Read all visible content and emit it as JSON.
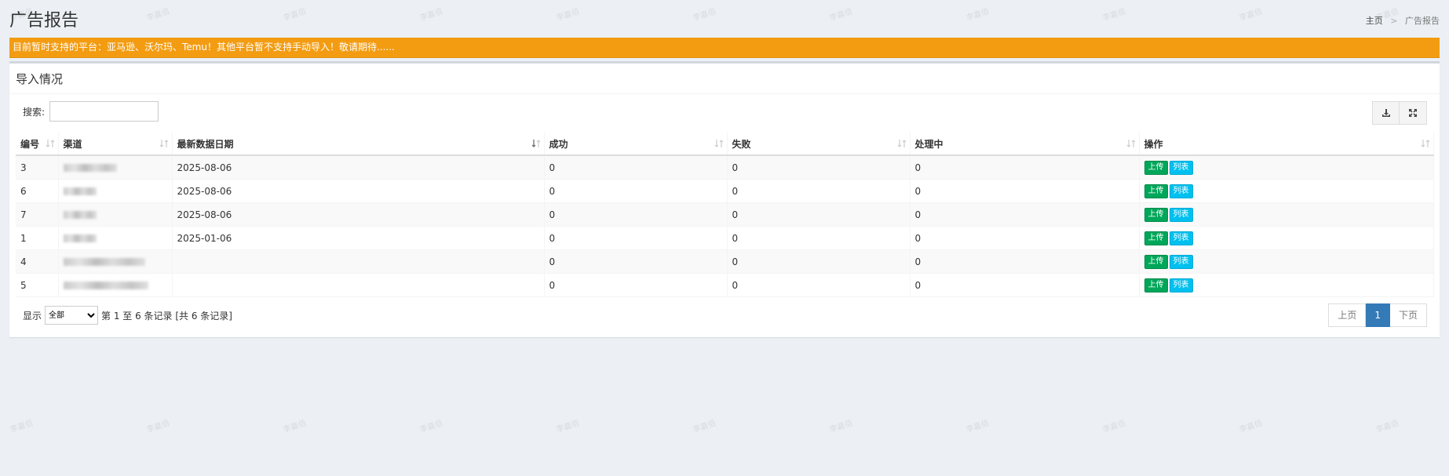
{
  "header": {
    "title": "广告报告",
    "breadcrumb": {
      "home": "主页",
      "separator": ">",
      "current": "广告报告"
    }
  },
  "notice": {
    "text": "目前暂时支持的平台：亚马逊、沃尔玛、Temu！其他平台暂不支持手动导入！敬请期待......"
  },
  "box": {
    "title": "导入情况",
    "search_label": "搜索:",
    "search_value": ""
  },
  "table": {
    "columns": [
      "编号",
      "渠道",
      "最新数据日期",
      "成功",
      "失败",
      "处理中",
      "操作"
    ],
    "rows": [
      {
        "id": "3",
        "channel": "",
        "date": "2025-08-06",
        "success": "0",
        "fail": "0",
        "processing": "0"
      },
      {
        "id": "6",
        "channel": "",
        "date": "2025-08-06",
        "success": "0",
        "fail": "0",
        "processing": "0"
      },
      {
        "id": "7",
        "channel": "",
        "date": "2025-08-06",
        "success": "0",
        "fail": "0",
        "processing": "0"
      },
      {
        "id": "1",
        "channel": "",
        "date": "2025-01-06",
        "success": "0",
        "fail": "0",
        "processing": "0"
      },
      {
        "id": "4",
        "channel": "",
        "date": "",
        "success": "0",
        "fail": "0",
        "processing": "0"
      },
      {
        "id": "5",
        "channel": "",
        "date": "",
        "success": "0",
        "fail": "0",
        "processing": "0"
      }
    ],
    "actions": {
      "upload": "上传",
      "list": "列表"
    }
  },
  "footer": {
    "show_label": "显示",
    "page_size": "全部",
    "info": "第 1 至 6 条记录 [共 6 条记录]",
    "pager": {
      "prev": "上页",
      "current": "1",
      "next": "下页"
    }
  },
  "watermark": "李嘉佰",
  "colors": {
    "notice_bg": "#f39c12",
    "upload_btn": "#00a65a",
    "list_btn": "#00c0ef",
    "active_page": "#337ab7"
  },
  "icons": {
    "export": "download-icon",
    "fullscreen": "expand-icon",
    "sort": "sort-icon"
  }
}
